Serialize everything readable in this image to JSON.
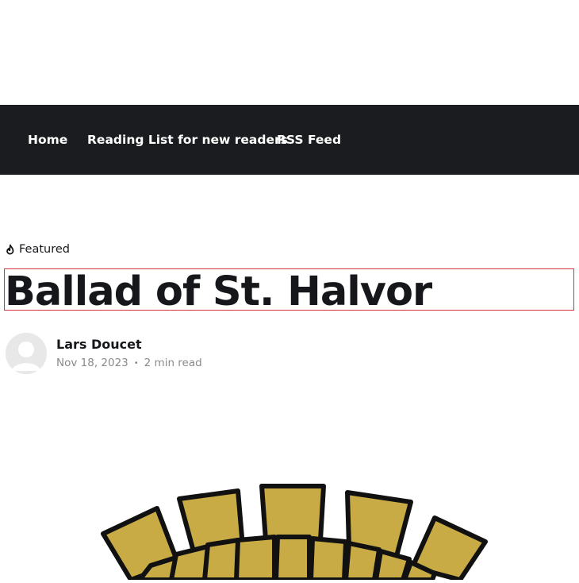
{
  "nav": {
    "items": [
      {
        "label": "Home"
      },
      {
        "label": "Reading List for new readers"
      },
      {
        "label": "RSS Feed"
      }
    ]
  },
  "post": {
    "tag": "Featured",
    "title": "Ballad of St. Halvor",
    "author": "Lars Doucet",
    "date": "Nov 18, 2023",
    "separator": "•",
    "reading_time": "2 min read"
  },
  "colors": {
    "nav_background": "#1b1c1f",
    "title_outline": "#d9303d",
    "tile_gold": "#c9ab45",
    "tile_outline": "#111111"
  },
  "icons": {
    "featured": "flame-icon",
    "avatar": "user-avatar-placeholder"
  }
}
